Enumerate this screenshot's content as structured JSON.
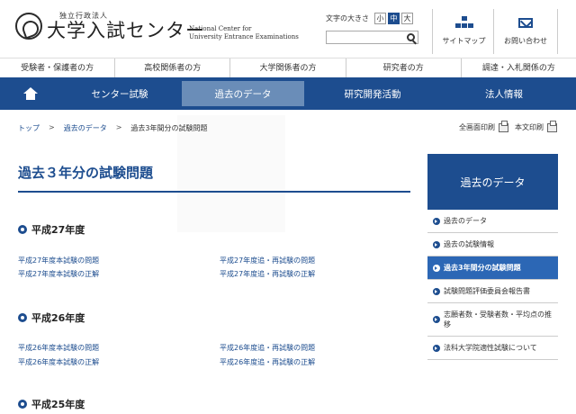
{
  "header": {
    "org_small": "独立行政法人",
    "org_name": "大学入試センター",
    "org_en_line1": "National Center for",
    "org_en_line2": "University Entrance Examinations",
    "font_size_label": "文字の大きさ",
    "font_sizes": [
      "小",
      "中",
      "大"
    ],
    "search_placeholder": "",
    "sitemap_label": "サイトマップ",
    "contact_label": "お問い合わせ"
  },
  "audience_nav": [
    "受験者・保護者の方",
    "高校関係者の方",
    "大学関係者の方",
    "研究者の方",
    "調達・入札関係の方"
  ],
  "main_nav": [
    "センター試験",
    "過去のデータ",
    "研究開発活動",
    "法人情報"
  ],
  "breadcrumb": [
    "トップ",
    "過去のデータ",
    "過去3年間分の試験問題"
  ],
  "print": {
    "full": "全画面印刷",
    "body": "本文印刷"
  },
  "page_title": "過去３年分の試験問題",
  "sections": [
    {
      "heading": "平成27年度",
      "links": [
        "平成27年度本試験の問題",
        "平成27年度追・再試験の問題",
        "平成27年度本試験の正解",
        "平成27年度追・再試験の正解"
      ]
    },
    {
      "heading": "平成26年度",
      "links": [
        "平成26年度本試験の問題",
        "平成26年度追・再試験の問題",
        "平成26年度本試験の正解",
        "平成26年度追・再試験の正解"
      ]
    },
    {
      "heading": "平成25年度",
      "links": []
    }
  ],
  "sidebar": {
    "title": "過去のデータ",
    "items": [
      "過去のデータ",
      "過去の試験情報",
      "過去3年間分の試験問題",
      "試験問題評価委員会報告書",
      "志願者数・受験者数・平均点の推移",
      "法科大学院適性試験について"
    ]
  },
  "colors": {
    "primary": "#1d4d8f",
    "nav_active": "#6a8db8",
    "sidebar_active": "#2c67b5"
  }
}
